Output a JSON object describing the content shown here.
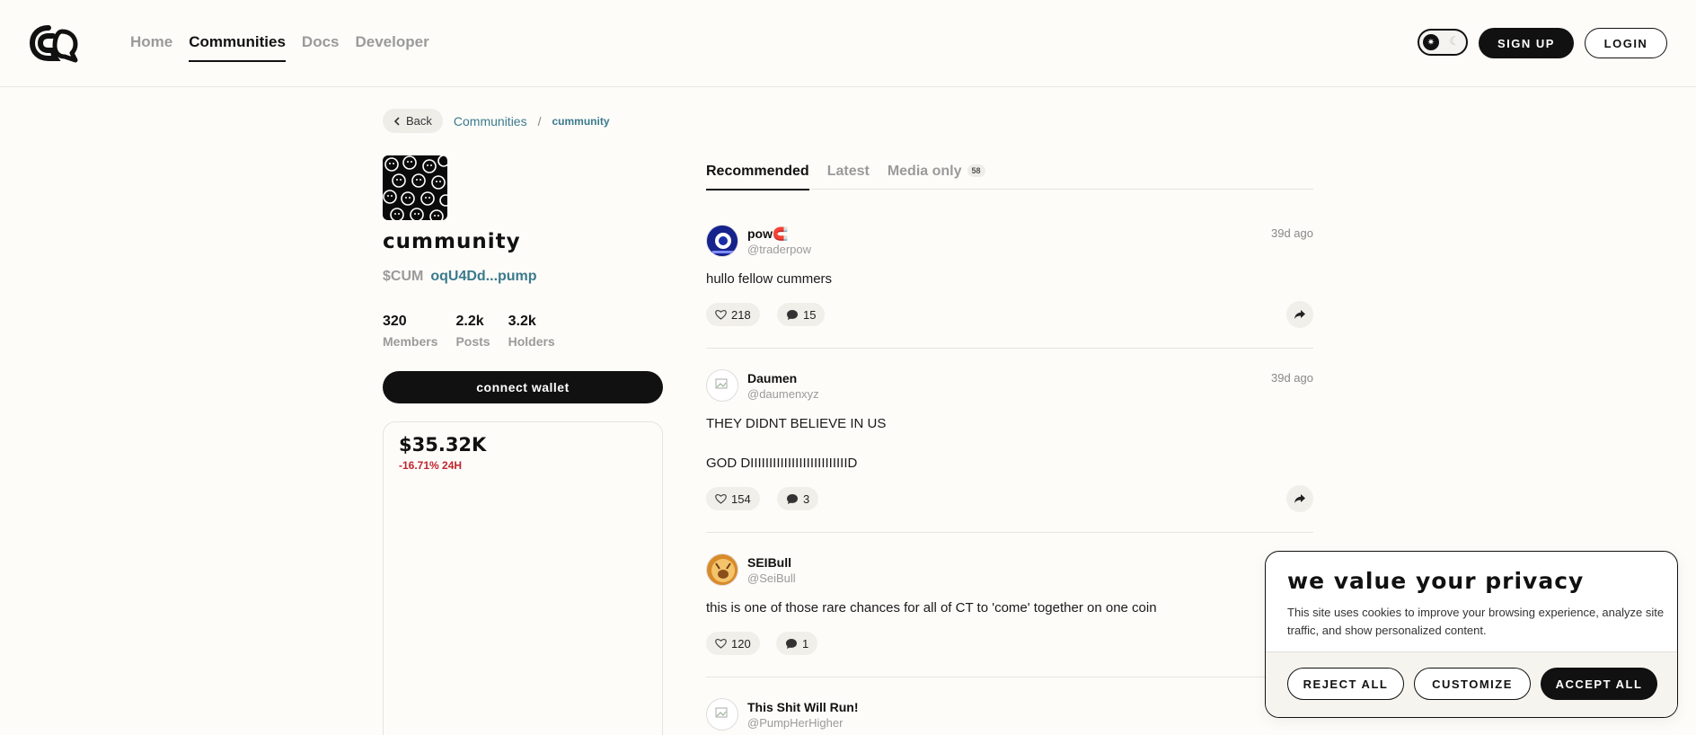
{
  "header": {
    "logo_icon": "chat-bubble-logo-icon",
    "nav": [
      {
        "label": "Home",
        "active": false
      },
      {
        "label": "Communities",
        "active": true
      },
      {
        "label": "Docs",
        "active": false
      },
      {
        "label": "Developer",
        "active": false
      }
    ],
    "signup_label": "SIGN UP",
    "login_label": "LOGIN"
  },
  "breadcrumb": {
    "back_label": "Back",
    "parent": "Communities",
    "separator": "/",
    "current": "cummunity"
  },
  "community": {
    "name": "cummunity",
    "ticker": "$CUM",
    "contract": "oqU4Dd...pump",
    "stats": [
      {
        "value": "320",
        "label": "Members"
      },
      {
        "value": "2.2k",
        "label": "Posts"
      },
      {
        "value": "3.2k",
        "label": "Holders"
      }
    ],
    "connect_label": "connect wallet",
    "price": "$35.32K",
    "price_change": "-16.71% 24H"
  },
  "tabs": [
    {
      "label": "Recommended",
      "active": true
    },
    {
      "label": "Latest",
      "active": false
    },
    {
      "label": "Media only",
      "active": false,
      "badge": "58"
    }
  ],
  "posts": [
    {
      "author": "pow🧲",
      "handle": "@traderpow",
      "time": "39d ago",
      "body": "hullo fellow cummers",
      "likes": "218",
      "comments": "15"
    },
    {
      "author": "Daumen",
      "handle": "@daumenxyz",
      "time": "39d ago",
      "body": "THEY DIDNT BELIEVE IN US\n\nGOD DIIIIIIIIIIIIIIIIIIIIIIIIIID",
      "likes": "154",
      "comments": "3"
    },
    {
      "author": "SEIBull",
      "handle": "@SeiBull",
      "time": "",
      "body": "this is one of those rare chances for all of CT to 'come' together on one coin",
      "likes": "120",
      "comments": "1"
    },
    {
      "author": "This Shit Will Run!",
      "handle": "@PumpHerHigher",
      "time": "",
      "body": "",
      "likes": "",
      "comments": ""
    }
  ],
  "cookie": {
    "title": "we value your privacy",
    "text": "This site uses cookies to improve your browsing experience, analyze site traffic, and show personalized content.",
    "reject_label": "REJECT ALL",
    "customize_label": "CUSTOMIZE",
    "accept_label": "ACCEPT ALL"
  },
  "colors": {
    "accent_link": "#3b7a8c",
    "negative": "#c0262d",
    "background": "#fdfcf9"
  }
}
